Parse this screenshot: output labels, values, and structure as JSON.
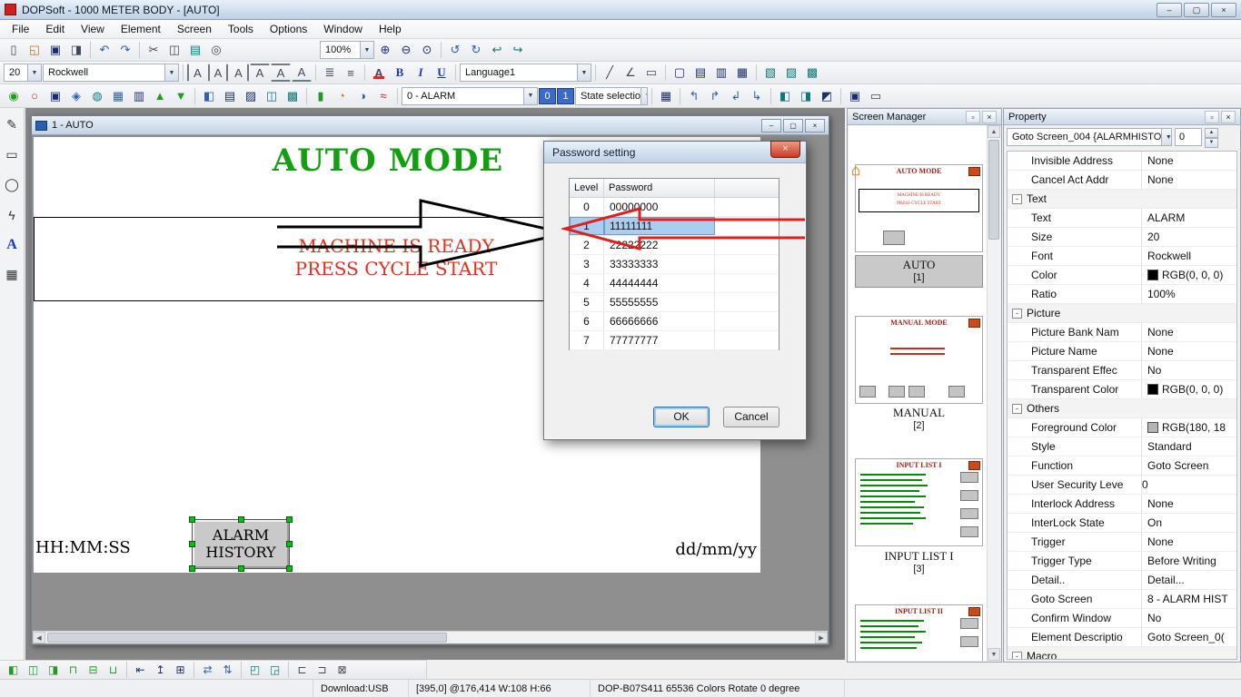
{
  "colors": {
    "titlebar": "#bcd0e6",
    "heading_green": "#12a012",
    "alert_red": "#e03020",
    "selection_blue": "#abceee",
    "mdi_gray": "#858585",
    "handle_green": "#00c010"
  },
  "ui": {
    "dropdown": "▼",
    "up": "▲",
    "down": "▼",
    "left": "◀",
    "right": "▶",
    "minimize": "–",
    "maximize": "▢",
    "restore": "▫",
    "close": "×",
    "expander": "-",
    "house": "⌂"
  },
  "titlebar": {
    "title": "DOPSoft - 1000 METER BODY - [AUTO]"
  },
  "menu": {
    "items": [
      "File",
      "Edit",
      "View",
      "Element",
      "Screen",
      "Tools",
      "Options",
      "Window",
      "Help"
    ]
  },
  "std": {
    "zoom": "100%",
    "icons": [
      {
        "n": "new-file",
        "g": "▯"
      },
      {
        "n": "open-folder",
        "g": "◱"
      },
      {
        "n": "save",
        "g": "▣"
      },
      {
        "n": "export",
        "g": "◨"
      },
      {
        "n": "undo",
        "g": "↶"
      },
      {
        "n": "redo",
        "g": "↷"
      },
      {
        "n": "cut",
        "g": "✂"
      },
      {
        "n": "copy",
        "g": "◫"
      },
      {
        "n": "paste",
        "g": "▤"
      },
      {
        "n": "find",
        "g": "◎"
      },
      {
        "n": "zoom-in",
        "g": "⊕"
      },
      {
        "n": "zoom-out",
        "g": "⊖"
      },
      {
        "n": "zoom-fit",
        "g": "⊙"
      },
      {
        "n": "rotate-left",
        "g": "↺"
      },
      {
        "n": "rotate-right",
        "g": "↻"
      },
      {
        "n": "nav-back",
        "g": "↩"
      },
      {
        "n": "nav-forward",
        "g": "↪"
      }
    ]
  },
  "fmt": {
    "size": "20",
    "font": "Rockwell",
    "language": "Language1",
    "align_icons": [
      {
        "n": "align-text-left",
        "g": "A"
      },
      {
        "n": "align-text-center",
        "g": "A"
      },
      {
        "n": "align-text-right",
        "g": "A"
      },
      {
        "n": "align-text-top",
        "g": "A"
      },
      {
        "n": "align-text-middle",
        "g": "A"
      },
      {
        "n": "align-text-bottom",
        "g": "A"
      }
    ],
    "spacing_icons": [
      {
        "n": "line-spacing",
        "g": "≣"
      },
      {
        "n": "char-spacing",
        "g": "≡"
      }
    ],
    "text_color": "A",
    "bold": "B",
    "italic": "I",
    "underline": "U",
    "right_icons": [
      {
        "n": "draw-line",
        "g": "╱"
      },
      {
        "n": "draw-polyline",
        "g": "∠"
      },
      {
        "n": "draw-frame",
        "g": "▭"
      },
      {
        "n": "state-frame",
        "g": "▢"
      },
      {
        "n": "text-banner",
        "g": "▤"
      },
      {
        "n": "scale-element",
        "g": "▥"
      },
      {
        "n": "table-grid",
        "g": "▦"
      },
      {
        "n": "hatch-fill",
        "g": "▧"
      },
      {
        "n": "pattern-fill",
        "g": "▨"
      },
      {
        "n": "shade-fill",
        "g": "▩"
      }
    ]
  },
  "elm": {
    "screen": "0 - ALARM",
    "s0": "0",
    "s1": "1",
    "state": "State selectio",
    "icons": [
      {
        "n": "on-button",
        "g": "◉"
      },
      {
        "n": "off-button",
        "g": "○"
      },
      {
        "n": "momentary-button",
        "g": "▣"
      },
      {
        "n": "maintained-button",
        "g": "◈"
      },
      {
        "n": "multistate-button",
        "g": "◍"
      },
      {
        "n": "set-value-button",
        "g": "▦"
      },
      {
        "n": "set-constant-button",
        "g": "▥"
      },
      {
        "n": "increment-button",
        "g": "▲"
      },
      {
        "n": "decrement-button",
        "g": "▼"
      },
      {
        "n": "goto-screen-button",
        "g": "◧"
      },
      {
        "n": "numeric-entry",
        "g": "▤"
      },
      {
        "n": "character-entry",
        "g": "▨"
      },
      {
        "n": "numeric-display",
        "g": "◫"
      },
      {
        "n": "message-display",
        "g": "▩"
      },
      {
        "n": "bar-graph",
        "g": "▮"
      },
      {
        "n": "meter",
        "g": "◔"
      },
      {
        "n": "pie-graph",
        "g": "◑"
      },
      {
        "n": "trend-graph",
        "g": "≈"
      }
    ],
    "right_icons": [
      {
        "n": "place-top-left",
        "g": "↰"
      },
      {
        "n": "place-top-right",
        "g": "↱"
      },
      {
        "n": "place-bottom-left",
        "g": "↲"
      },
      {
        "n": "place-bottom-right",
        "g": "↳"
      },
      {
        "n": "grid-toggle",
        "g": "▦"
      },
      {
        "n": "monitor-window",
        "g": "◧"
      },
      {
        "n": "simulate",
        "g": "◨"
      },
      {
        "n": "overlap-elements",
        "g": "◩"
      },
      {
        "n": "macro-editor",
        "g": "▣"
      },
      {
        "n": "ruler",
        "g": "▭"
      }
    ]
  },
  "lefttools": {
    "icons": [
      {
        "n": "pencil-tool",
        "g": "✎"
      },
      {
        "n": "rectangle-tool",
        "g": "▭"
      },
      {
        "n": "ellipse-tool",
        "g": "◯"
      },
      {
        "n": "polygon-tool",
        "g": "ϟ"
      },
      {
        "n": "text-tool",
        "g": "A"
      },
      {
        "n": "table-tool",
        "g": "▦"
      }
    ]
  },
  "child": {
    "title": "1 - AUTO",
    "canvas": {
      "heading": "AUTO MODE",
      "ready1": "MACHINE IS READY",
      "ready2": "PRESS CYCLE START",
      "time": "HH:MM:SS",
      "date": "dd/mm/yy",
      "alarm_btn_line1": "ALARM",
      "alarm_btn_line2": "HISTORY"
    }
  },
  "dialog": {
    "title": "Password setting",
    "col_level": "Level",
    "col_password": "Password",
    "rows": [
      {
        "level": "0",
        "password": "00000000"
      },
      {
        "level": "1",
        "password": "11111111"
      },
      {
        "level": "2",
        "password": "22222222"
      },
      {
        "level": "3",
        "password": "33333333"
      },
      {
        "level": "4",
        "password": "44444444"
      },
      {
        "level": "5",
        "password": "55555555"
      },
      {
        "level": "6",
        "password": "66666666"
      },
      {
        "level": "7",
        "password": "77777777"
      }
    ],
    "ok": "OK",
    "cancel": "Cancel"
  },
  "screen_manager": {
    "title": "Screen Manager",
    "thumbs": [
      {
        "header": "AUTO MODE",
        "line1": "MACHINE IS READY",
        "line2": "PRESS CYCLE START",
        "caption": "AUTO",
        "num": "[1]"
      },
      {
        "header": "MANUAL MODE",
        "caption": "MANUAL",
        "num": "[2]"
      },
      {
        "header": "INPUT LIST I",
        "caption": "INPUT LIST I",
        "num": "[3]"
      },
      {
        "header": "INPUT LIST II",
        "caption": "",
        "num": ""
      }
    ]
  },
  "property": {
    "title": "Property",
    "selector": "Goto Screen_004 {ALARMHISTO",
    "spin_value": "0",
    "rows": [
      {
        "t": "p",
        "label": "Invisible Address",
        "value": "None"
      },
      {
        "t": "p",
        "label": "Cancel Act Addr",
        "value": "None"
      },
      {
        "t": "g",
        "label": "Text"
      },
      {
        "t": "p",
        "label": "Text",
        "value": "ALARM"
      },
      {
        "t": "p",
        "label": "Size",
        "value": "20"
      },
      {
        "t": "p",
        "label": "Font",
        "value": "Rockwell"
      },
      {
        "t": "c",
        "label": "Color",
        "value": "RGB(0, 0, 0)",
        "swatch": "#000000"
      },
      {
        "t": "p",
        "label": "Ratio",
        "value": "100%"
      },
      {
        "t": "g",
        "label": "Picture"
      },
      {
        "t": "p",
        "label": "Picture Bank Nam",
        "value": "None"
      },
      {
        "t": "p",
        "label": "Picture Name",
        "value": "None"
      },
      {
        "t": "p",
        "label": "Transparent Effec",
        "value": "No"
      },
      {
        "t": "c",
        "label": "Transparent Color",
        "value": "RGB(0, 0, 0)",
        "swatch": "#000000"
      },
      {
        "t": "g",
        "label": "Others"
      },
      {
        "t": "c",
        "label": "Foreground Color",
        "value": "RGB(180, 18",
        "swatch": "#b4b4b4"
      },
      {
        "t": "p",
        "label": "Style",
        "value": "Standard"
      },
      {
        "t": "p",
        "label": "Function",
        "value": "Goto Screen"
      },
      {
        "t": "p",
        "label": "User Security Leve",
        "value": "0"
      },
      {
        "t": "p",
        "label": "Interlock Address",
        "value": "None"
      },
      {
        "t": "p",
        "label": "InterLock State",
        "value": "On"
      },
      {
        "t": "p",
        "label": "Trigger",
        "value": "None"
      },
      {
        "t": "p",
        "label": "Trigger Type",
        "value": "Before Writing"
      },
      {
        "t": "p",
        "label": "Detail..",
        "value": "Detail..."
      },
      {
        "t": "p",
        "label": "Goto Screen",
        "value": "8 - ALARM HIST"
      },
      {
        "t": "p",
        "label": "Confirm Window",
        "value": "No"
      },
      {
        "t": "p",
        "label": "Element Descriptio",
        "value": "Goto Screen_0("
      },
      {
        "t": "g",
        "label": "Macro"
      }
    ]
  },
  "bottom": {
    "icons": [
      {
        "n": "align-lefts",
        "g": "◧"
      },
      {
        "n": "align-centers",
        "g": "◫"
      },
      {
        "n": "align-rights",
        "g": "◨"
      },
      {
        "n": "align-tops",
        "g": "⊓"
      },
      {
        "n": "align-middles",
        "g": "⊟"
      },
      {
        "n": "align-bottoms",
        "g": "⊔"
      },
      {
        "n": "same-width",
        "g": "⇤"
      },
      {
        "n": "same-height",
        "g": "↥"
      },
      {
        "n": "same-size",
        "g": "⊞"
      },
      {
        "n": "space-across",
        "g": "⇄"
      },
      {
        "n": "space-down",
        "g": "⇅"
      },
      {
        "n": "bring-to-front",
        "g": "◰"
      },
      {
        "n": "send-to-back",
        "g": "◲"
      },
      {
        "n": "group",
        "g": "⊏"
      },
      {
        "n": "ungroup",
        "g": "⊐"
      },
      {
        "n": "fix-element",
        "g": "⊠"
      }
    ]
  },
  "statusbar": {
    "download": "Download:USB",
    "coords": "[395,0] @176,414 W:108 H:66",
    "device": "DOP-B07S411 65536 Colors Rotate 0 degree"
  }
}
